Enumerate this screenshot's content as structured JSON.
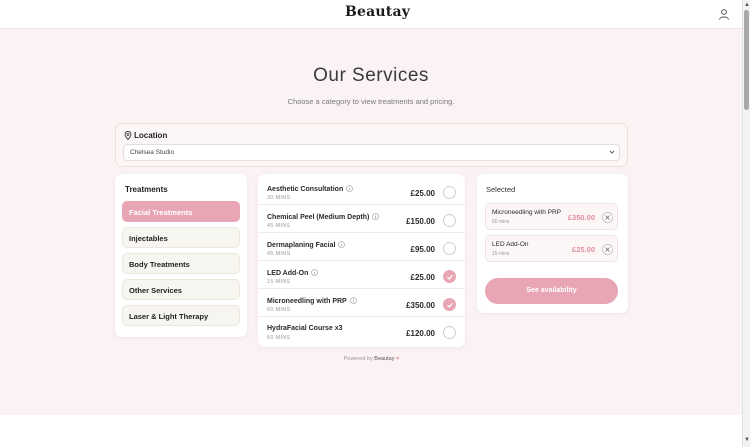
{
  "header": {
    "logo_text": "Beautay",
    "account_icon": "user-icon"
  },
  "page": {
    "title": "Our Services",
    "subtitle": "Choose a category to view treatments and pricing."
  },
  "location": {
    "label": "Location",
    "icon": "map-pin-icon",
    "selected_value": "Chelsea Studio"
  },
  "categories": {
    "title": "Treatments",
    "items": [
      {
        "label": "Facial Treatments",
        "active": true
      },
      {
        "label": "Injectables",
        "active": false
      },
      {
        "label": "Body Treatments",
        "active": false
      },
      {
        "label": "Other Services",
        "active": false
      },
      {
        "label": "Laser & Light Therapy",
        "active": false
      }
    ]
  },
  "services": [
    {
      "name": "Aesthetic Consultation",
      "duration": "30 MINS",
      "price": "£25.00",
      "info": true,
      "selected": false
    },
    {
      "name": "Chemical Peel (Medium Depth)",
      "duration": "45 MINS",
      "price": "£150.00",
      "info": true,
      "selected": false
    },
    {
      "name": "Dermaplaning Facial",
      "duration": "45 MINS",
      "price": "£95.00",
      "info": true,
      "selected": false
    },
    {
      "name": "LED Add-On",
      "duration": "15 MINS",
      "price": "£25.00",
      "info": true,
      "selected": true
    },
    {
      "name": "Microneedling with PRP",
      "duration": "60 MINS",
      "price": "£350.00",
      "info": true,
      "selected": true
    },
    {
      "name": "HydraFacial Course x3",
      "duration": "60 MINS",
      "price": "£120.00",
      "info": false,
      "selected": false
    }
  ],
  "powered_by": {
    "prefix": "Powered by",
    "brand": "Beautay",
    "heart": "♥"
  },
  "selected_panel": {
    "title": "Selected",
    "items": [
      {
        "name": "Microneedling with PRP",
        "duration": "60 mins",
        "price": "£350.00"
      },
      {
        "name": "LED Add-On",
        "duration": "15 mins",
        "price": "£25.00"
      }
    ],
    "cta_label": "See availability"
  },
  "colors": {
    "accent": "#e8a5b4",
    "price_accent": "#e08fa2",
    "page_background": "#fbf3f3"
  }
}
